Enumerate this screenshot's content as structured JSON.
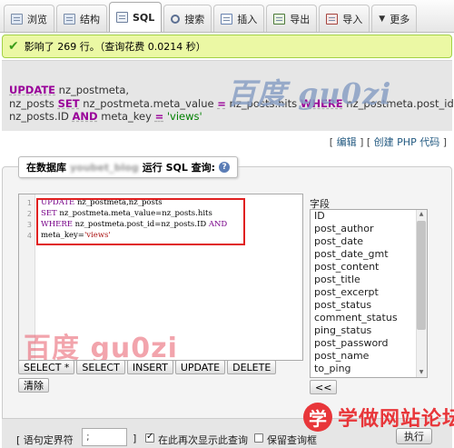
{
  "tabs": [
    {
      "label": "浏览",
      "icon": "browse-icon"
    },
    {
      "label": "结构",
      "icon": "structure-icon"
    },
    {
      "label": "SQL",
      "icon": "sql-icon",
      "active": true
    },
    {
      "label": "搜索",
      "icon": "search-icon"
    },
    {
      "label": "插入",
      "icon": "insert-icon"
    },
    {
      "label": "导出",
      "icon": "export-icon"
    },
    {
      "label": "导入",
      "icon": "import-icon"
    },
    {
      "label": "更多",
      "icon": "chevron-down-icon"
    }
  ],
  "success": {
    "message": "影响了 269 行。（查询花费 0.0214 秒）"
  },
  "query": {
    "line1_kw": "UPDATE",
    "line1_rest": " nz_postmeta,",
    "line2_a": "nz_posts ",
    "line2_kw": "SET",
    "line2_b": " nz_postmeta.meta_value ",
    "line2_eq": "=",
    "line2_c": " nz_posts.hits ",
    "line2_kw2": "WHERE",
    "line2_d": " nz_postmeta.post_id ",
    "line2_eq2": "=",
    "line3_a": "nz_posts.ID ",
    "line3_kw": "AND",
    "line3_b": " meta_key ",
    "line3_eq": "=",
    "line3_str": " 'views'"
  },
  "watermark_top": "百度 gu0zi",
  "links": {
    "edit": "编辑",
    "create_php": "创建 PHP 代码"
  },
  "legend": {
    "prefix": "在数据库",
    "db_name": "youbet_blog",
    "suffix": "运行 SQL 查询:"
  },
  "editor": {
    "line_numbers": [
      "1",
      "2",
      "3",
      "4"
    ],
    "l1_kw": "UPDATE",
    "l1_rest": " nz_postmeta,nz_posts",
    "l2_kw": "SET",
    "l2_rest": " nz_postmeta.meta_value=nz_posts.hits",
    "l3_kw": "WHERE",
    "l3_a": "  nz_postmeta.post_id=nz_posts.ID ",
    "l3_kw2": "AND",
    "l4_a": "meta_key=",
    "l4_str": "'views'"
  },
  "watermark_mid": "百度 gu0zi",
  "buttons": [
    "SELECT *",
    "SELECT",
    "INSERT",
    "UPDATE",
    "DELETE"
  ],
  "clear_label": "清除",
  "fields": {
    "title": "字段",
    "items": [
      "ID",
      "post_author",
      "post_date",
      "post_date_gmt",
      "post_content",
      "post_title",
      "post_excerpt",
      "post_status",
      "comment_status",
      "ping_status",
      "post_password",
      "post_name",
      "to_ping"
    ],
    "back_label": "<<"
  },
  "footer": {
    "delimiter_label": "[ 语句定界符",
    "delimiter_value": ";",
    "close_bracket": "]",
    "show_again_label": "在此再次显示此查询",
    "keep_box_label": "保留查询框",
    "execute_label": "执行"
  },
  "site_logo": {
    "mark": "学",
    "text": "学做网站论坛"
  }
}
